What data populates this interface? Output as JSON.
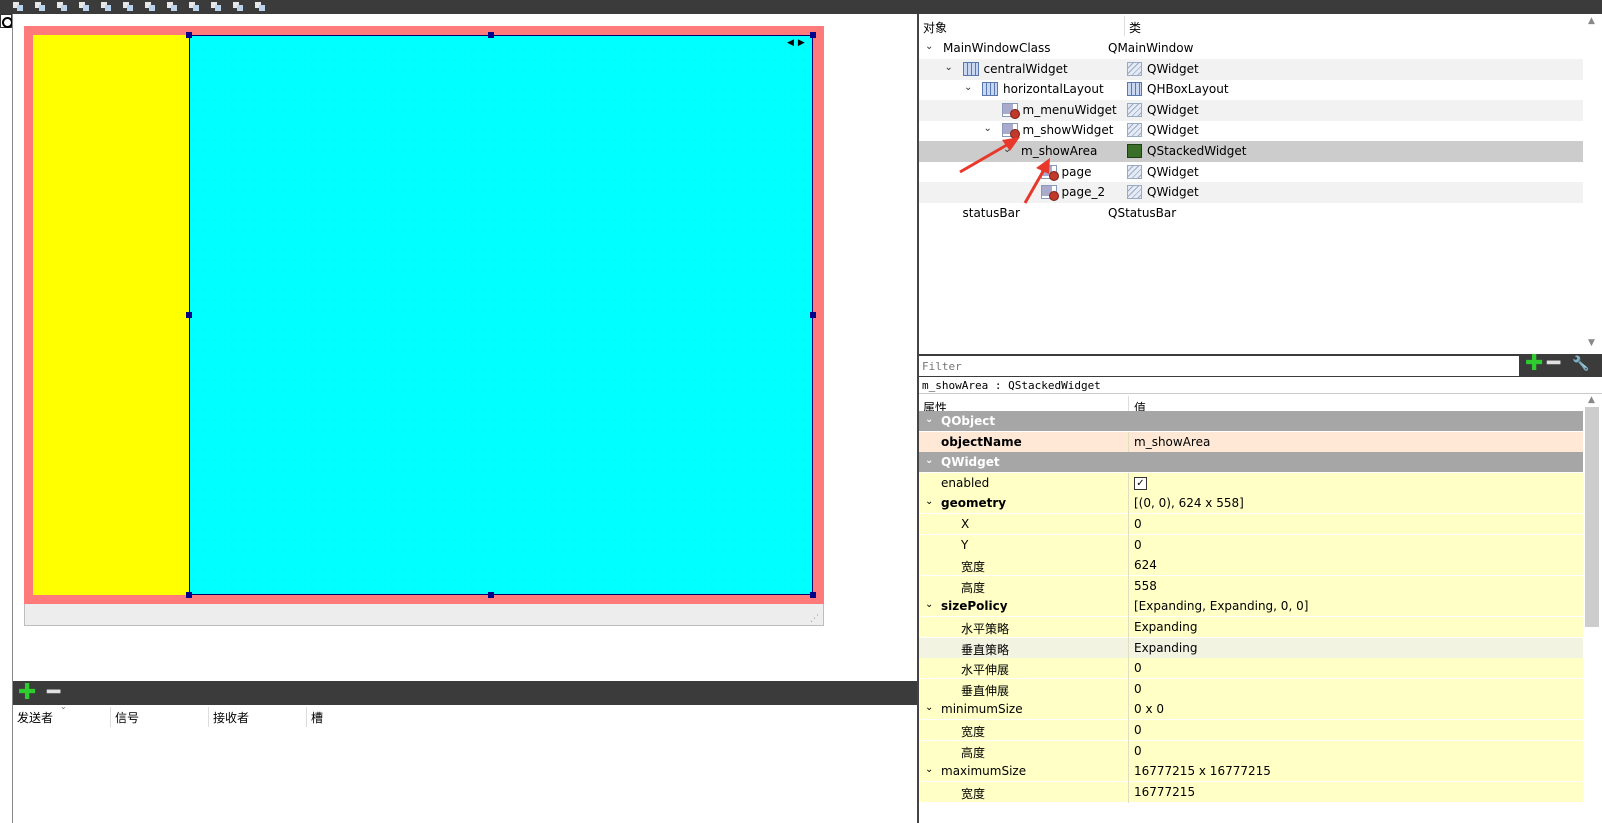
{
  "filter": {
    "placeholder": "Filter"
  },
  "selected_object_label": "m_showArea : QStackedWidget",
  "object_inspector": {
    "headers": {
      "object": "对象",
      "class": "类"
    },
    "rows": [
      {
        "name": "MainWindowClass",
        "class": "QMainWindow",
        "expand": "v",
        "icon": "none",
        "class_icon": "none"
      },
      {
        "name": "centralWidget",
        "class": "QWidget",
        "expand": "v",
        "icon": "layout",
        "class_icon": "widget"
      },
      {
        "name": "horizontalLayout",
        "class": "QHBoxLayout",
        "expand": "v",
        "icon": "layout",
        "class_icon": "layout"
      },
      {
        "name": "m_menuWidget",
        "class": "QWidget",
        "expand": "",
        "icon": "forbidden",
        "class_icon": "widget"
      },
      {
        "name": "m_showWidget",
        "class": "QWidget",
        "expand": "v",
        "icon": "forbidden",
        "class_icon": "widget"
      },
      {
        "name": "m_showArea",
        "class": "QStackedWidget",
        "expand": "v",
        "icon": "none",
        "class_icon": "stack"
      },
      {
        "name": "page",
        "class": "QWidget",
        "expand": "",
        "icon": "forbidden",
        "class_icon": "widget"
      },
      {
        "name": "page_2",
        "class": "QWidget",
        "expand": "",
        "icon": "forbidden",
        "class_icon": "widget"
      },
      {
        "name": "statusBar",
        "class": "QStatusBar",
        "expand": "",
        "icon": "none",
        "class_icon": "none"
      }
    ]
  },
  "property_editor": {
    "headers": {
      "property": "属性",
      "value": "值"
    },
    "rows": [
      {
        "type": "group",
        "name": "QObject",
        "value": ""
      },
      {
        "type": "prop",
        "name": "objectName",
        "value": "m_showArea"
      },
      {
        "type": "group",
        "name": "QWidget",
        "value": ""
      },
      {
        "type": "prop",
        "name": "enabled",
        "value": "✓"
      },
      {
        "type": "prop",
        "name": "geometry",
        "value": "[(0, 0), 624 x 558]"
      },
      {
        "type": "sub",
        "name": "X",
        "value": "0"
      },
      {
        "type": "sub",
        "name": "Y",
        "value": "0"
      },
      {
        "type": "sub",
        "name": "宽度",
        "value": "624"
      },
      {
        "type": "sub",
        "name": "高度",
        "value": "558"
      },
      {
        "type": "prop",
        "name": "sizePolicy",
        "value": "[Expanding, Expanding, 0, 0]"
      },
      {
        "type": "sub",
        "name": "水平策略",
        "value": "Expanding"
      },
      {
        "type": "sub",
        "name": "垂直策略",
        "value": "Expanding"
      },
      {
        "type": "sub",
        "name": "水平伸展",
        "value": "0"
      },
      {
        "type": "sub",
        "name": "垂直伸展",
        "value": "0"
      },
      {
        "type": "prop",
        "name": "minimumSize",
        "value": "0 x 0"
      },
      {
        "type": "sub",
        "name": "宽度",
        "value": "0"
      },
      {
        "type": "sub",
        "name": "高度",
        "value": "0"
      },
      {
        "type": "prop",
        "name": "maximumSize",
        "value": "16777215 x 16777215"
      },
      {
        "type": "sub",
        "name": "宽度",
        "value": "16777215"
      }
    ]
  },
  "signal_slot_editor": {
    "columns": [
      "发送者",
      "信号",
      "接收者",
      "槽"
    ]
  },
  "colors": {
    "menu_widget": "#ffff00",
    "show_area": "#00ffff",
    "central_widget": "#ff7b7b",
    "selection_handle": "#00008b",
    "annotation_arrow": "#e8382c"
  }
}
